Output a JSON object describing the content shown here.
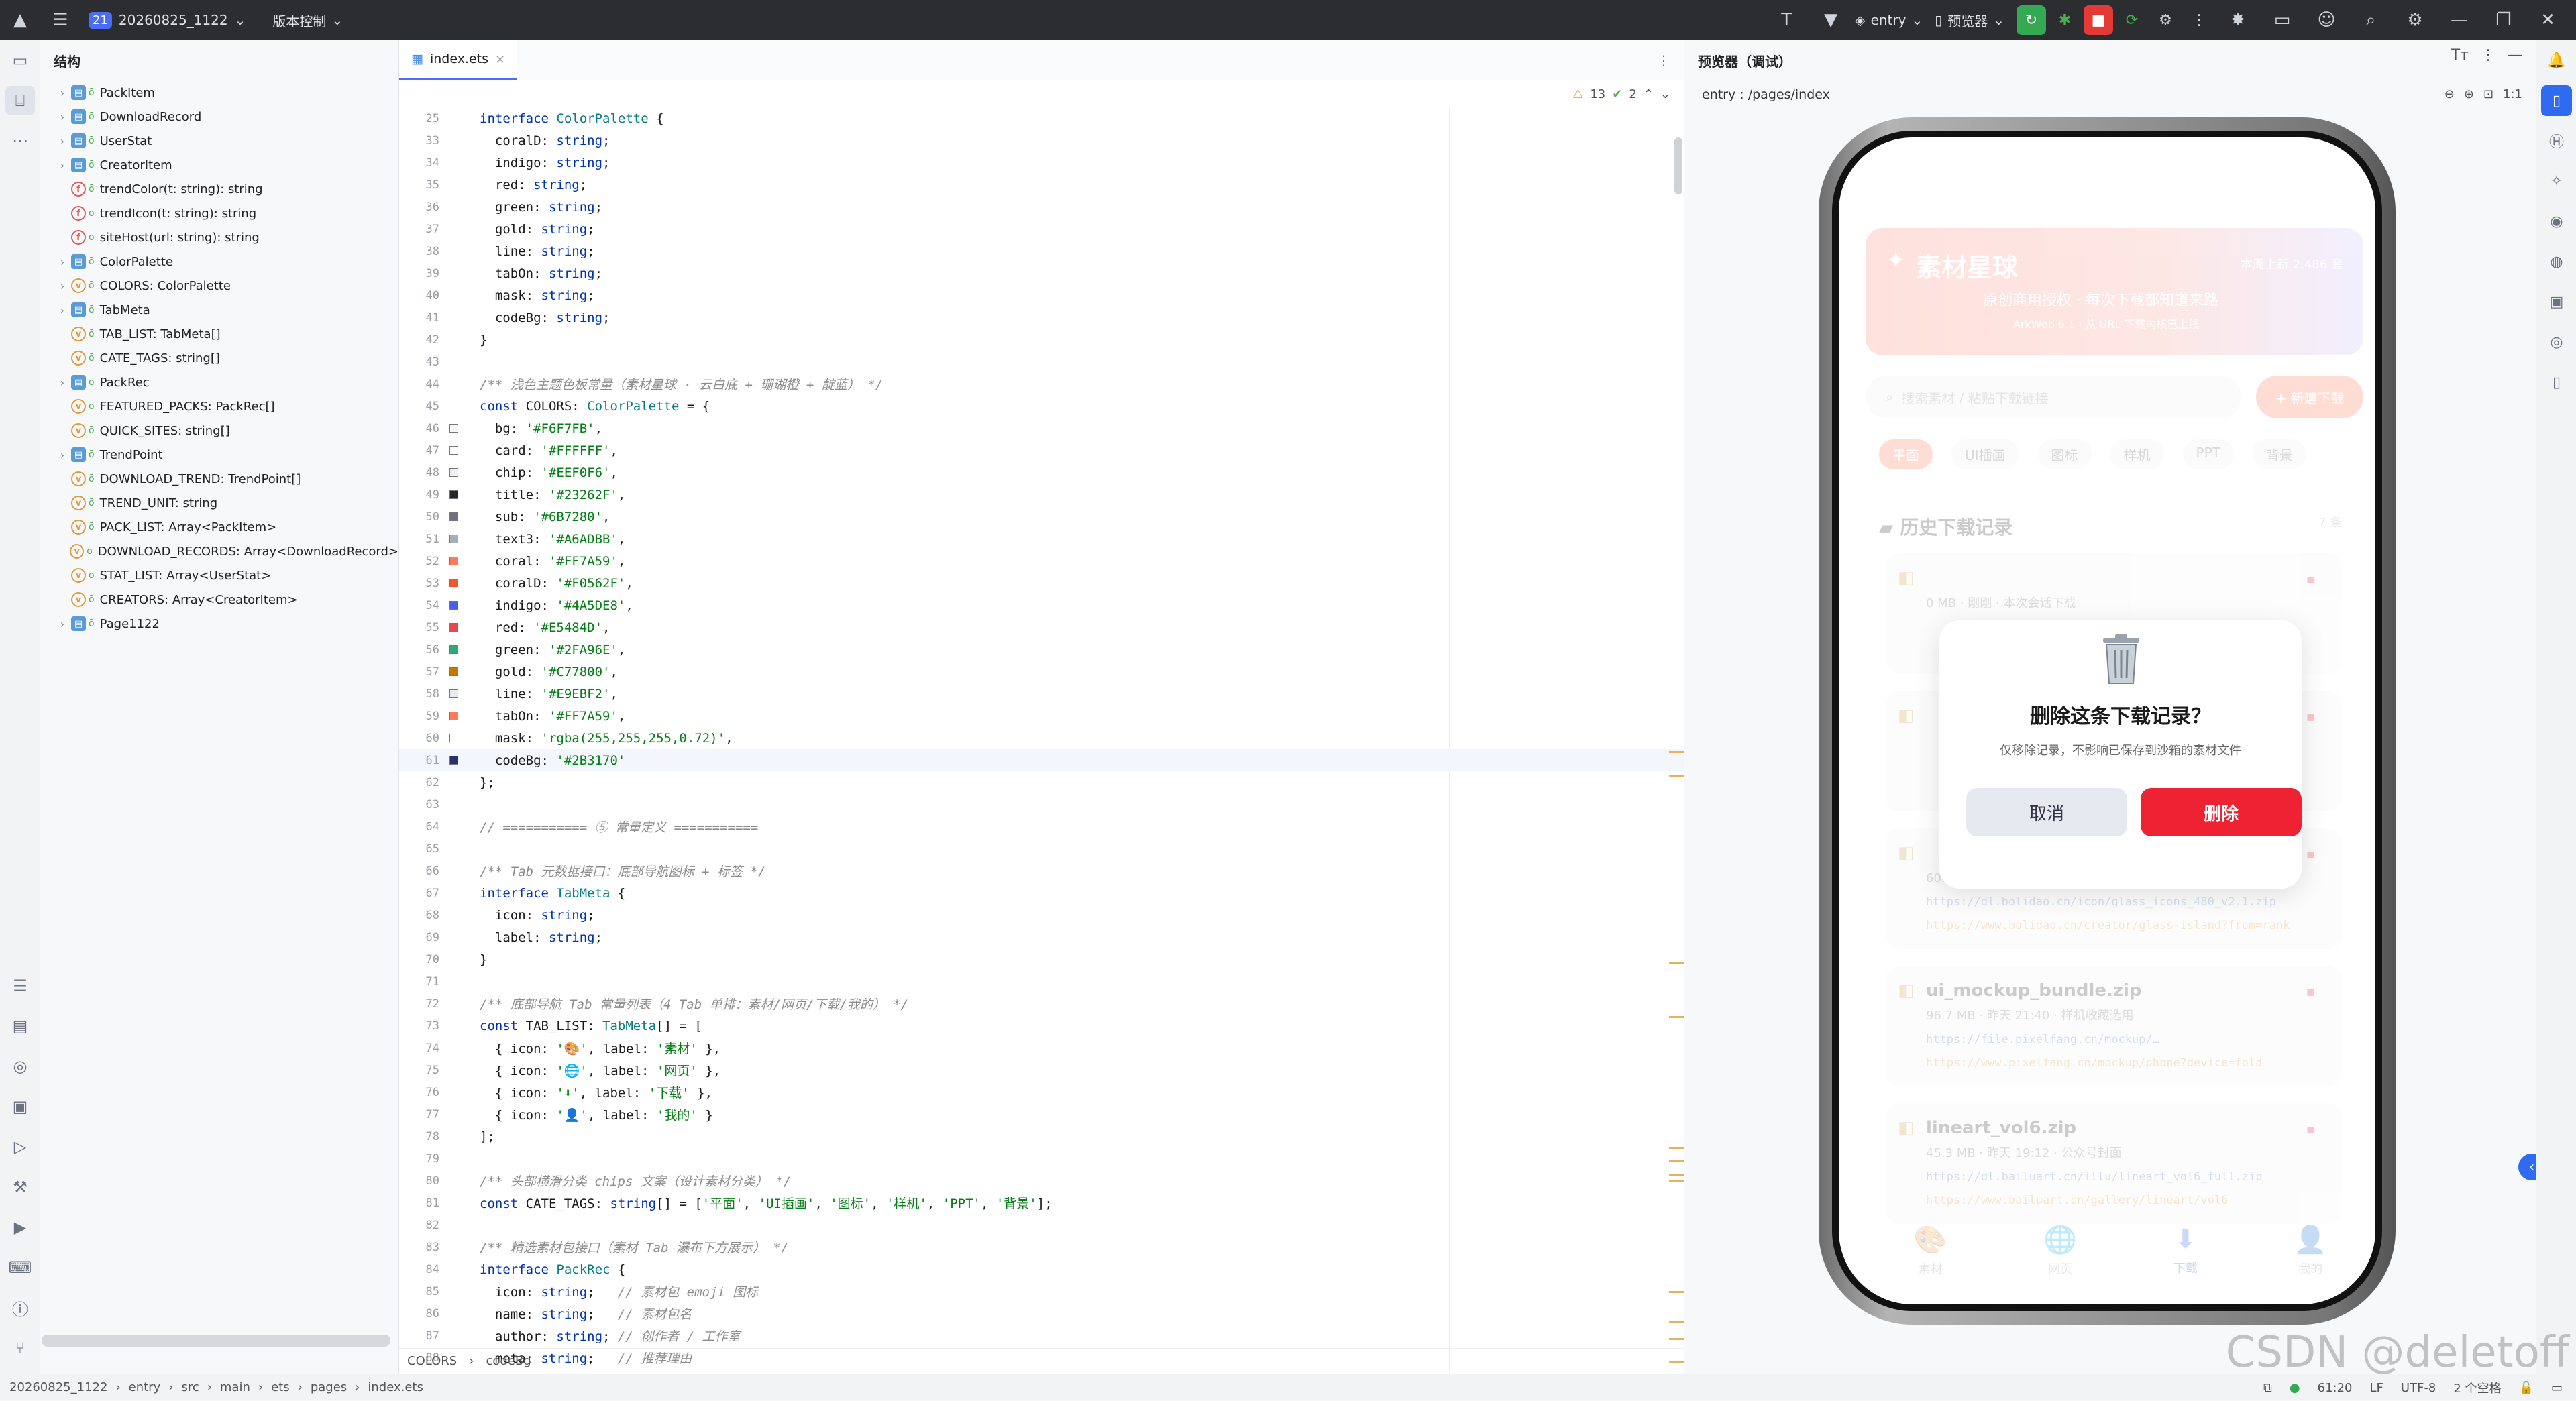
{
  "topbar": {
    "project_badge": "21",
    "project_name": "20260825_1122",
    "vcs": "版本控制",
    "run_target": "entry",
    "previewer": "预览器"
  },
  "structure": {
    "title": "结构",
    "items": [
      {
        "kind": "class",
        "label": "PackItem",
        "expandable": true
      },
      {
        "kind": "class",
        "label": "DownloadRecord",
        "expandable": true
      },
      {
        "kind": "class",
        "label": "UserStat",
        "expandable": true
      },
      {
        "kind": "class",
        "label": "CreatorItem",
        "expandable": true
      },
      {
        "kind": "func",
        "label": "trendColor(t: string): string",
        "expandable": false
      },
      {
        "kind": "func",
        "label": "trendIcon(t: string): string",
        "expandable": false
      },
      {
        "kind": "func",
        "label": "siteHost(url: string): string",
        "expandable": false
      },
      {
        "kind": "class",
        "label": "ColorPalette",
        "expandable": true
      },
      {
        "kind": "var",
        "label": "COLORS: ColorPalette",
        "expandable": true
      },
      {
        "kind": "class",
        "label": "TabMeta",
        "expandable": true
      },
      {
        "kind": "var",
        "label": "TAB_LIST: TabMeta[]",
        "expandable": false
      },
      {
        "kind": "var",
        "label": "CATE_TAGS: string[]",
        "expandable": false
      },
      {
        "kind": "class",
        "label": "PackRec",
        "expandable": true
      },
      {
        "kind": "var",
        "label": "FEATURED_PACKS: PackRec[]",
        "expandable": false
      },
      {
        "kind": "var",
        "label": "QUICK_SITES: string[]",
        "expandable": false
      },
      {
        "kind": "class",
        "label": "TrendPoint",
        "expandable": true
      },
      {
        "kind": "var",
        "label": "DOWNLOAD_TREND: TrendPoint[]",
        "expandable": false
      },
      {
        "kind": "var",
        "label": "TREND_UNIT: string",
        "expandable": false
      },
      {
        "kind": "var",
        "label": "PACK_LIST: Array<PackItem>",
        "expandable": false
      },
      {
        "kind": "var",
        "label": "DOWNLOAD_RECORDS: Array<DownloadRecord>",
        "expandable": false
      },
      {
        "kind": "var",
        "label": "STAT_LIST: Array<UserStat>",
        "expandable": false
      },
      {
        "kind": "var",
        "label": "CREATORS: Array<CreatorItem>",
        "expandable": false
      },
      {
        "kind": "class",
        "label": "Page1122",
        "expandable": true
      }
    ]
  },
  "editor": {
    "tab": "index.ets",
    "inspection": {
      "warnings": "13",
      "weak": "2"
    },
    "lines": [
      {
        "n": "25",
        "code": "interface ColorPalette {",
        "swatch": ""
      },
      {
        "n": "33",
        "code": "  coralD: string;",
        "swatch": ""
      },
      {
        "n": "34",
        "code": "  indigo: string;",
        "swatch": ""
      },
      {
        "n": "35",
        "code": "  red: string;",
        "swatch": ""
      },
      {
        "n": "36",
        "code": "  green: string;",
        "swatch": ""
      },
      {
        "n": "37",
        "code": "  gold: string;",
        "swatch": ""
      },
      {
        "n": "38",
        "code": "  line: string;",
        "swatch": ""
      },
      {
        "n": "39",
        "code": "  tabOn: string;",
        "swatch": ""
      },
      {
        "n": "40",
        "code": "  mask: string;",
        "swatch": ""
      },
      {
        "n": "41",
        "code": "  codeBg: string;",
        "swatch": ""
      },
      {
        "n": "42",
        "code": "}",
        "swatch": ""
      },
      {
        "n": "43",
        "code": "",
        "swatch": ""
      },
      {
        "n": "44",
        "code": "/** 浅色主题色板常量（素材星球 · 云白底 + 珊瑚橙 + 靛蓝） */",
        "swatch": ""
      },
      {
        "n": "45",
        "code": "const COLORS: ColorPalette = {",
        "swatch": ""
      },
      {
        "n": "46",
        "code": "  bg: '#F6F7FB',",
        "swatch": "#F6F7FB"
      },
      {
        "n": "47",
        "code": "  card: '#FFFFFF',",
        "swatch": "#FFFFFF"
      },
      {
        "n": "48",
        "code": "  chip: '#EEF0F6',",
        "swatch": "#EEF0F6"
      },
      {
        "n": "49",
        "code": "  title: '#23262F',",
        "swatch": "#23262F"
      },
      {
        "n": "50",
        "code": "  sub: '#6B7280',",
        "swatch": "#6B7280"
      },
      {
        "n": "51",
        "code": "  text3: '#A6ADBB',",
        "swatch": "#A6ADBB"
      },
      {
        "n": "52",
        "code": "  coral: '#FF7A59',",
        "swatch": "#FF7A59"
      },
      {
        "n": "53",
        "code": "  coralD: '#F0562F',",
        "swatch": "#F0562F"
      },
      {
        "n": "54",
        "code": "  indigo: '#4A5DE8',",
        "swatch": "#4A5DE8"
      },
      {
        "n": "55",
        "code": "  red: '#E5484D',",
        "swatch": "#E5484D"
      },
      {
        "n": "56",
        "code": "  green: '#2FA96E',",
        "swatch": "#2FA96E"
      },
      {
        "n": "57",
        "code": "  gold: '#C77800',",
        "swatch": "#C77800"
      },
      {
        "n": "58",
        "code": "  line: '#E9EBF2',",
        "swatch": "#E9EBF2"
      },
      {
        "n": "59",
        "code": "  tabOn: '#FF7A59',",
        "swatch": "#FF7A59"
      },
      {
        "n": "60",
        "code": "  mask: 'rgba(255,255,255,0.72)',",
        "swatch": "#FFFFFF"
      },
      {
        "n": "61",
        "code": "  codeBg: '#2B3170'",
        "swatch": "#2B3170"
      },
      {
        "n": "62",
        "code": "};",
        "swatch": ""
      },
      {
        "n": "63",
        "code": "",
        "swatch": ""
      },
      {
        "n": "64",
        "code": "// =========== ⑤ 常量定义 ===========",
        "swatch": ""
      },
      {
        "n": "65",
        "code": "",
        "swatch": ""
      },
      {
        "n": "66",
        "code": "/** Tab 元数据接口：底部导航图标 + 标签 */",
        "swatch": ""
      },
      {
        "n": "67",
        "code": "interface TabMeta {",
        "swatch": ""
      },
      {
        "n": "68",
        "code": "  icon: string;",
        "swatch": ""
      },
      {
        "n": "69",
        "code": "  label: string;",
        "swatch": ""
      },
      {
        "n": "70",
        "code": "}",
        "swatch": ""
      },
      {
        "n": "71",
        "code": "",
        "swatch": ""
      },
      {
        "n": "72",
        "code": "/** 底部导航 Tab 常量列表（4 Tab 单排：素材/网页/下载/我的） */",
        "swatch": ""
      },
      {
        "n": "73",
        "code": "const TAB_LIST: TabMeta[] = [",
        "swatch": ""
      },
      {
        "n": "74",
        "code": "  { icon: '🎨', label: '素材' },",
        "swatch": ""
      },
      {
        "n": "75",
        "code": "  { icon: '🌐', label: '网页' },",
        "swatch": ""
      },
      {
        "n": "76",
        "code": "  { icon: '⬇', label: '下载' },",
        "swatch": ""
      },
      {
        "n": "77",
        "code": "  { icon: '👤', label: '我的' }",
        "swatch": ""
      },
      {
        "n": "78",
        "code": "];",
        "swatch": ""
      },
      {
        "n": "79",
        "code": "",
        "swatch": ""
      },
      {
        "n": "80",
        "code": "/** 头部横滑分类 chips 文案（设计素材分类） */",
        "swatch": ""
      },
      {
        "n": "81",
        "code": "const CATE_TAGS: string[] = ['平面', 'UI插画', '图标', '样机', 'PPT', '背景'];",
        "swatch": ""
      },
      {
        "n": "82",
        "code": "",
        "swatch": ""
      },
      {
        "n": "83",
        "code": "/** 精选素材包接口（素材 Tab 瀑布下方展示） */",
        "swatch": ""
      },
      {
        "n": "84",
        "code": "interface PackRec {",
        "swatch": ""
      },
      {
        "n": "85",
        "code": "  icon: string;   // 素材包 emoji 图标",
        "swatch": ""
      },
      {
        "n": "86",
        "code": "  name: string;   // 素材包名",
        "swatch": ""
      },
      {
        "n": "87",
        "code": "  author: string; // 创作者 / 工作室",
        "swatch": ""
      },
      {
        "n": "88",
        "code": "  meta: string;   // 推荐理由",
        "swatch": ""
      }
    ],
    "breadcrumb": [
      "COLORS",
      "codeBg"
    ]
  },
  "preview": {
    "title": "预览器（调试）",
    "path": "entry : /pages/index",
    "app": {
      "title": "素材星球",
      "usage": "本周上新 2,486 套",
      "subtitle": "原创商用授权 · 每次下载都知道来路",
      "subtitle2": "ArkWeb 6.1 · 从 URL 下载内核已上线",
      "search_placeholder": "搜索素材 / 粘贴下载链接",
      "new_download": "+ 新建下载",
      "chips": [
        "平面",
        "UI插画",
        "图标",
        "样机",
        "PPT",
        "背景"
      ],
      "history_title": "历史下载记录",
      "history_count": "7 条",
      "records": [
        {
          "name": "",
          "meta": "0 MB · 刚刚 · 本次会话下载",
          "l1": "",
          "l2": ""
        },
        {
          "name": "",
          "meta": "",
          "l1": "",
          "l2": ""
        },
        {
          "name": "",
          "meta": "60.2 MB · 昨天 09:02 · 金融图标规范",
          "l1": "https://dl.bolidao.cn/icon/glass_icons_480_v2.1.zip",
          "l2": "https://www.bolidao.cn/creator/glass-island?from=rank"
        },
        {
          "name": "ui_mockup_bundle.zip",
          "meta": "96.7 MB · 昨天 21:40 · 样机收藏选用",
          "l1": "https://file.pixelfang.cn/mockup/…",
          "l2": "https://www.pixelfang.cn/mockup/phone?device=fold"
        },
        {
          "name": "lineart_vol6.zip",
          "meta": "45.3 MB · 昨天 19:12 · 公众号封面",
          "l1": "https://dl.bailuart.cn/illu/lineart_vol6_full.zip",
          "l2": "https://www.bailuart.cn/gallery/lineart/vol6"
        }
      ],
      "tabs": [
        {
          "icon": "🎨",
          "label": "素材"
        },
        {
          "icon": "🌐",
          "label": "网页"
        },
        {
          "icon": "⬇",
          "label": "下载"
        },
        {
          "icon": "👤",
          "label": "我的"
        }
      ]
    },
    "dialog": {
      "title": "删除这条下载记录？",
      "desc": "仅移除记录，不影响已保存到沙箱的素材文件",
      "cancel": "取消",
      "confirm": "删除"
    }
  },
  "statusbar": {
    "path": [
      "20260825_1122",
      "entry",
      "src",
      "main",
      "ets",
      "pages",
      "index.ets"
    ],
    "cursor": "61:20",
    "line_sep": "LF",
    "encoding": "UTF-8",
    "indent": "2 个空格"
  },
  "watermark": "CSDN @deletoff",
  "colors": {
    "accent": "#4A6CF7",
    "coral": "#FF7A59",
    "danger": "#EE2233"
  }
}
